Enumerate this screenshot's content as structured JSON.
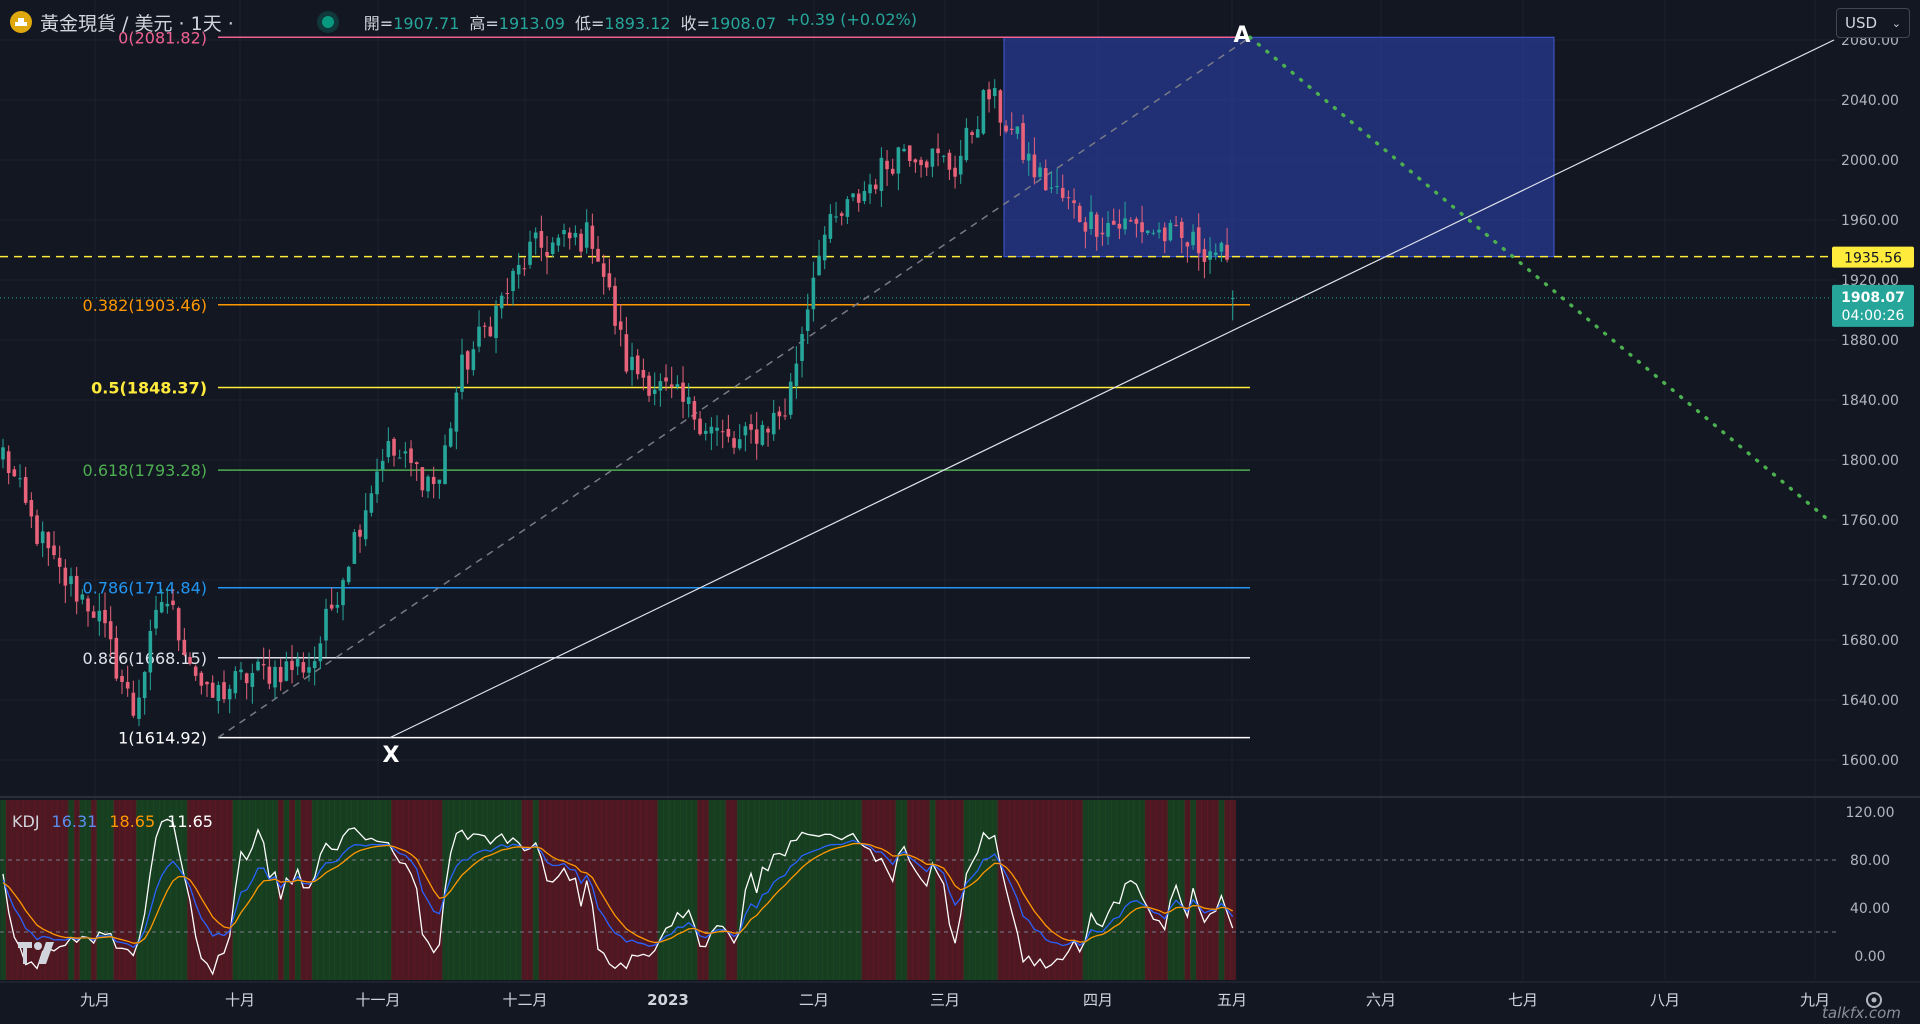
{
  "header": {
    "symbol": "黃金現貨 / 美元 · 1天 ·",
    "open_label": "開",
    "open": "1907.71",
    "high_label": "高",
    "high": "1913.09",
    "low_label": "低",
    "low": "1893.12",
    "close_label": "收",
    "close": "1908.07",
    "change": "+0.39 (+0.02%)"
  },
  "currency_selector": "USD",
  "colors": {
    "background": "#131722",
    "up": "#26a69a",
    "down": "#ef5350",
    "kdj_k": "#2962ff",
    "kdj_d": "#ff9800",
    "kdj_j": "#ffffff",
    "box": "#2a3fa8",
    "current_price_tag": "#26a69a",
    "dashed_level": "#ffeb3b"
  },
  "kdj_legend": {
    "name": "KDJ",
    "k": "16.31",
    "d": "18.65",
    "j": "11.65"
  },
  "watermark": "talkfx.com",
  "chart_data": {
    "type": "candlestick",
    "price_axis": {
      "min": 1580,
      "max": 2100,
      "ticks": [
        "2080.00",
        "2040.00",
        "2000.00",
        "1960.00",
        "1920.00",
        "1880.00",
        "1840.00",
        "1800.00",
        "1760.00",
        "1720.00",
        "1680.00",
        "1640.00",
        "1600.00"
      ]
    },
    "time_axis_labels": [
      "九月",
      "十月",
      "十一月",
      "十二月",
      "2023",
      "二月",
      "三月",
      "四月",
      "五月",
      "六月",
      "七月",
      "八月",
      "九月"
    ],
    "fib_levels": [
      {
        "label": "0(2081.82)",
        "ratio": 0,
        "price": 2081.82,
        "color": "#f06292"
      },
      {
        "label": "0.382(1903.46)",
        "ratio": 0.382,
        "price": 1903.46,
        "color": "#ff9800"
      },
      {
        "label": "0.5(1848.37)",
        "ratio": 0.5,
        "price": 1848.37,
        "color": "#ffeb3b"
      },
      {
        "label": "0.618(1793.28)",
        "ratio": 0.618,
        "price": 1793.28,
        "color": "#4caf50"
      },
      {
        "label": "0.786(1714.84)",
        "ratio": 0.786,
        "price": 1714.84,
        "color": "#2196f3"
      },
      {
        "label": "0.886(1668.15)",
        "ratio": 0.886,
        "price": 1668.15,
        "color": "#e0e3eb"
      },
      {
        "label": "1(1614.92)",
        "ratio": 1,
        "price": 1614.92,
        "color": "#ffffff"
      }
    ],
    "dashed_level": {
      "price": 1935.56,
      "label": "1935.56"
    },
    "last_price": {
      "price": 1908.07,
      "label": "1908.07",
      "countdown": "04:00:26"
    },
    "points": [
      {
        "label": "X",
        "date": "十一月",
        "price": 1614.92
      },
      {
        "label": "A",
        "date": "五月",
        "price": 2081.82
      }
    ],
    "kdj_axis": {
      "min": -20,
      "max": 130,
      "ticks": [
        "120.00",
        "80.00",
        "40.00",
        "0.00"
      ],
      "reference_lines": [
        80,
        20
      ]
    },
    "kdj_latest": {
      "K": 16.31,
      "D": 18.65,
      "J": 11.65
    },
    "candles": []
  }
}
